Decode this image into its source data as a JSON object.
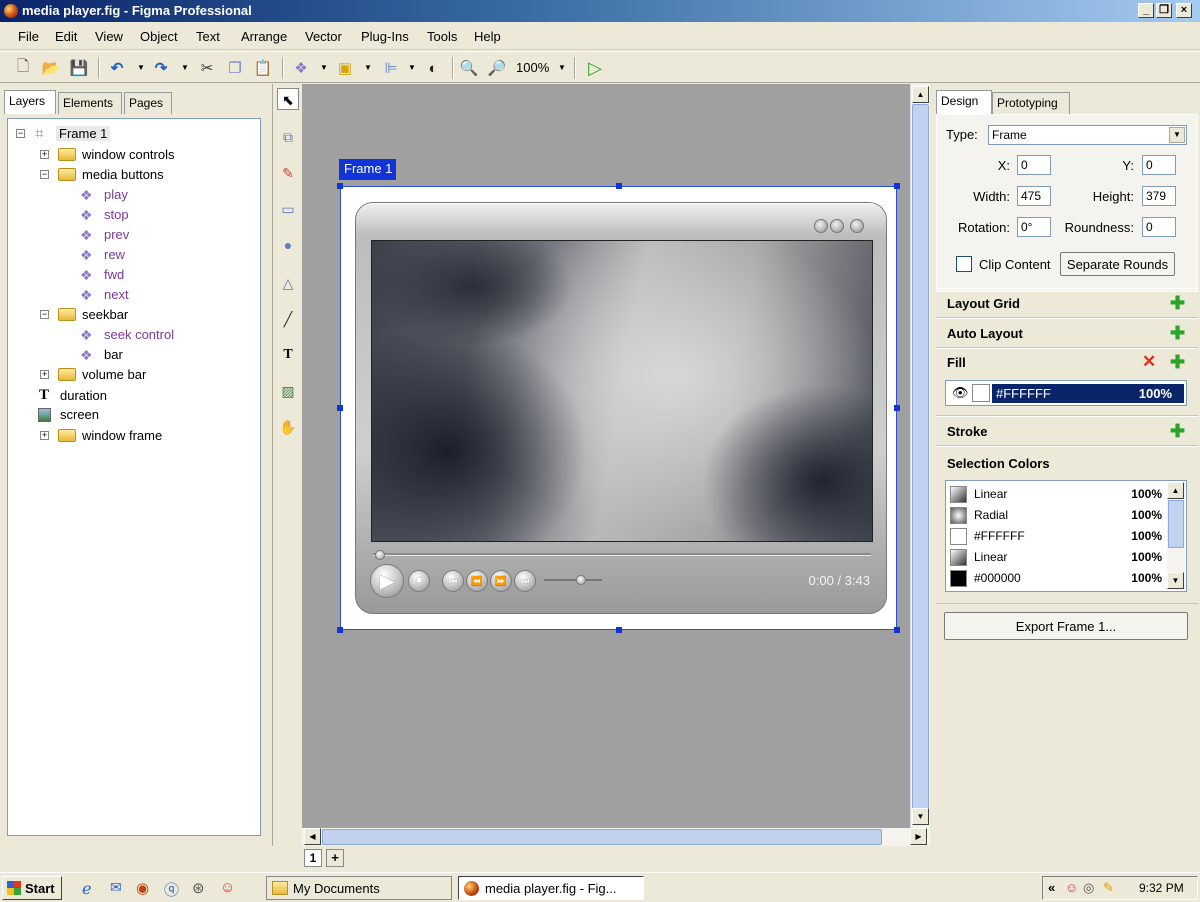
{
  "window": {
    "title": "media player.fig - Figma Professional"
  },
  "menu": [
    "File",
    "Edit",
    "View",
    "Object",
    "Text",
    "Arrange",
    "Vector",
    "Plug-Ins",
    "Tools",
    "Help"
  ],
  "toolbar": {
    "zoom": "100%"
  },
  "left_panel": {
    "tabs": [
      "Layers",
      "Elements",
      "Pages"
    ],
    "layers": [
      {
        "name": "Frame 1",
        "kind": "frame",
        "level": 0,
        "expander": "−"
      },
      {
        "name": "window controls",
        "kind": "folder",
        "level": 1,
        "expander": "+"
      },
      {
        "name": "media buttons",
        "kind": "folder",
        "level": 1,
        "expander": "−"
      },
      {
        "name": "play",
        "kind": "component",
        "level": 2
      },
      {
        "name": "stop",
        "kind": "component",
        "level": 2
      },
      {
        "name": "prev",
        "kind": "component",
        "level": 2
      },
      {
        "name": "rew",
        "kind": "component",
        "level": 2
      },
      {
        "name": "fwd",
        "kind": "component",
        "level": 2
      },
      {
        "name": "next",
        "kind": "component",
        "level": 2
      },
      {
        "name": "seekbar",
        "kind": "folder",
        "level": 1,
        "expander": "−"
      },
      {
        "name": "seek control",
        "kind": "component",
        "level": 2
      },
      {
        "name": "bar",
        "kind": "component-plain",
        "level": 2
      },
      {
        "name": "volume bar",
        "kind": "folder",
        "level": 1,
        "expander": "+"
      },
      {
        "name": "duration",
        "kind": "text",
        "level": 1
      },
      {
        "name": "screen",
        "kind": "image",
        "level": 1
      },
      {
        "name": "window frame",
        "kind": "folder",
        "level": 1,
        "expander": "+"
      }
    ]
  },
  "canvas": {
    "frame_label": "Frame 1",
    "player": {
      "duration": "0:00 / 3:43"
    }
  },
  "right_panel": {
    "tabs": [
      "Design",
      "Prototyping"
    ],
    "type_label": "Type:",
    "type_value": "Frame",
    "x_label": "X:",
    "x_value": "0",
    "y_label": "Y:",
    "y_value": "0",
    "width_label": "Width:",
    "width_value": "475",
    "height_label": "Height:",
    "height_value": "379",
    "rotation_label": "Rotation:",
    "rotation_value": "0°",
    "roundness_label": "Roundness:",
    "roundness_value": "0",
    "clip_content": "Clip Content",
    "separate_rounds": "Separate Rounds",
    "sections": {
      "layout_grid": "Layout Grid",
      "auto_layout": "Auto Layout",
      "fill": "Fill",
      "stroke": "Stroke",
      "selection_colors": "Selection Colors"
    },
    "fill": {
      "color": "#FFFFFF",
      "opacity": "100%"
    },
    "selection_colors": [
      {
        "name": "Linear",
        "opacity": "100%",
        "swatch": "linear"
      },
      {
        "name": "Radial",
        "opacity": "100%",
        "swatch": "radial"
      },
      {
        "name": "#FFFFFF",
        "opacity": "100%",
        "swatch": "#FFFFFF"
      },
      {
        "name": "Linear",
        "opacity": "100%",
        "swatch": "linear"
      },
      {
        "name": "#000000",
        "opacity": "100%",
        "swatch": "#000000"
      }
    ],
    "export_button": "Export Frame 1..."
  },
  "page_tabs": {
    "current": "1",
    "add": "+"
  },
  "taskbar": {
    "start": "Start",
    "tasks": [
      "My Documents",
      "media player.fig - Fig..."
    ],
    "tray_expand": "«",
    "time": "9:32 PM"
  },
  "colors": {
    "selection": "#1034D8",
    "plus": "#2AA52A",
    "delete": "#E0301E",
    "component": "#7B3A96"
  }
}
